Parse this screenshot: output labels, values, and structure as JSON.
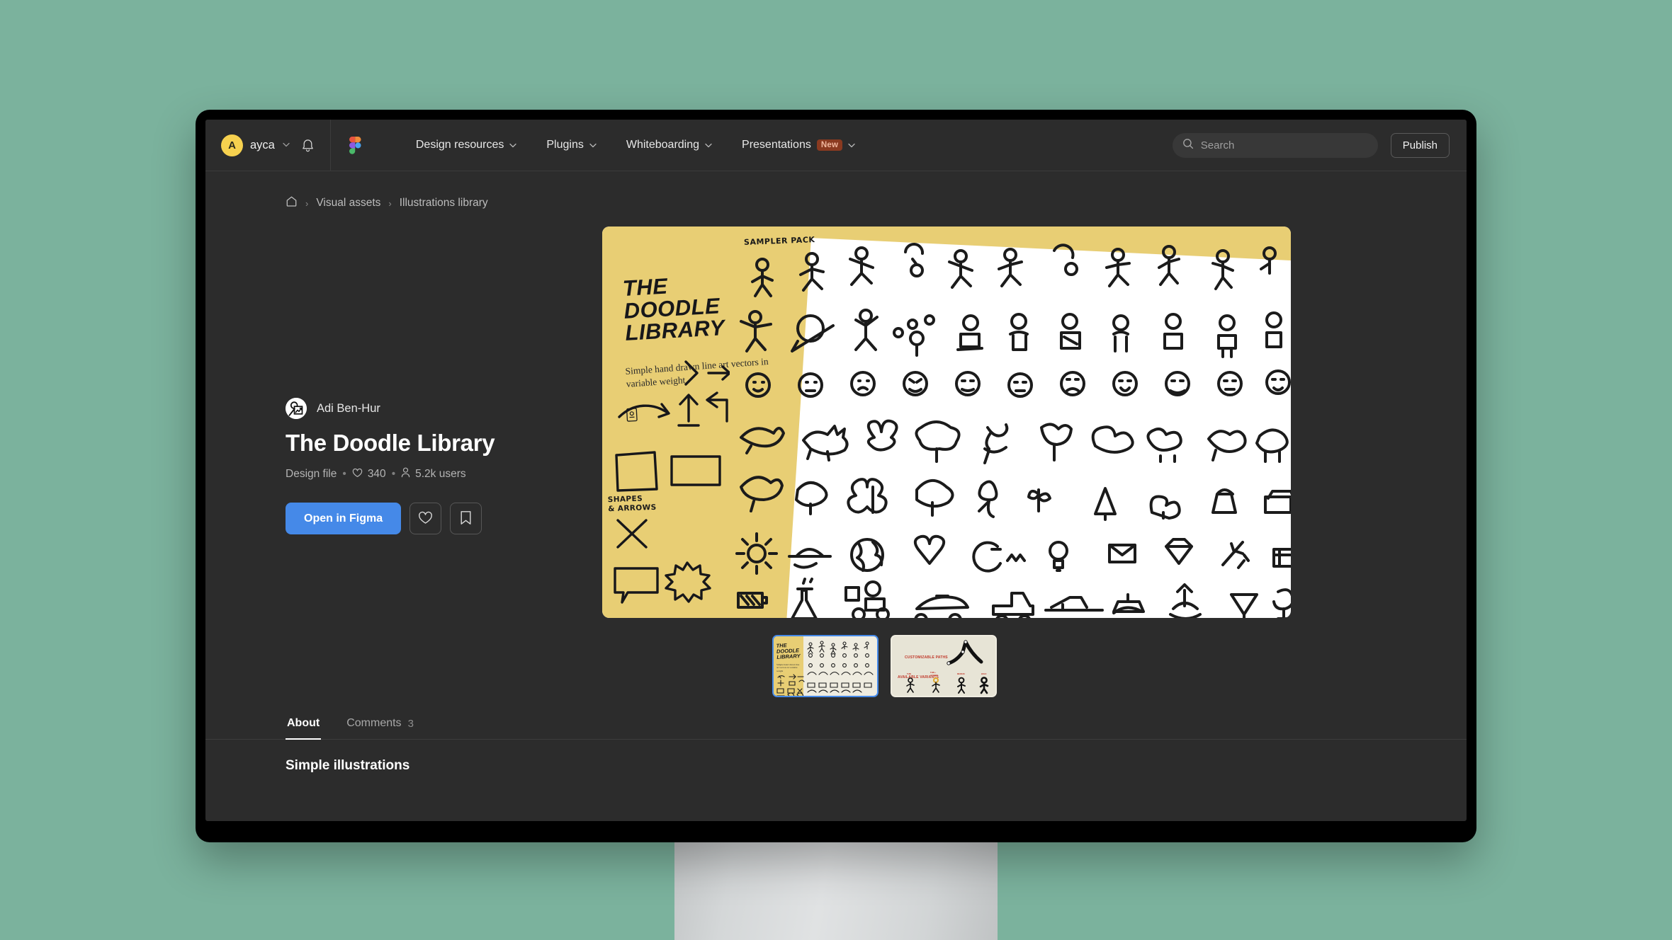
{
  "theme": {
    "page_background": "#7bb29d",
    "screen_background": "#2c2c2c",
    "accent_blue": "#4589e8",
    "avatar_yellow": "#f6d14f",
    "illustration_yellow": "#e8ce74"
  },
  "topbar": {
    "account": {
      "avatar_initial": "A",
      "name": "ayca",
      "caret": "⌄"
    },
    "notifications_icon": "bell-icon",
    "brand_icon": "figma-logo-icon",
    "nav_items": [
      {
        "label": "Design resources",
        "has_caret": true,
        "badge": ""
      },
      {
        "label": "Plugins",
        "has_caret": true,
        "badge": ""
      },
      {
        "label": "Whiteboarding",
        "has_caret": true,
        "badge": ""
      },
      {
        "label": "Presentations",
        "has_caret": true,
        "badge": "New"
      }
    ],
    "search": {
      "placeholder": "Search",
      "value": "",
      "icon": "search-icon"
    },
    "publish_label": "Publish"
  },
  "breadcrumb": {
    "home_icon": "home-icon",
    "separator": "›",
    "items": [
      "Visual assets",
      "Illustrations library"
    ]
  },
  "resource": {
    "author": "Adi Ben-Hur",
    "author_avatar_icon": "author-avatar-icon",
    "title": "The Doodle Library",
    "type_label": "Design file",
    "likes": "340",
    "likes_icon": "heart-icon",
    "users": "5.2k users",
    "users_icon": "person-icon",
    "separator": "•",
    "primary_action": "Open in Figma",
    "like_button_icon": "heart-outline-icon",
    "save_button_icon": "bookmark-icon"
  },
  "preview": {
    "cover_title": "THE\nDOODLE\nLIBRARY",
    "cover_subtitle": "Simple hand drawn line art vectors in variable weight",
    "label_sampler": "SAMPLER PACK",
    "label_shapes": "SHAPES\n& ARROWS",
    "cover_mark": "⛃"
  },
  "thumbnails": [
    {
      "name": "thumb-cover-grid",
      "selected": true,
      "title": "THE\nDOODLE\nLIBRARY",
      "subtitle": "Simple hand drawn line art vectors in variable weight"
    },
    {
      "name": "thumb-customizable-paths",
      "selected": false,
      "label_paths": "CUSTOMIZABLE PATHS",
      "label_variants": "AVAILABLE VARIANTS",
      "variants": [
        "THIN",
        "THIN + ACCENT",
        "MEDIUM",
        "BOLD"
      ]
    }
  ],
  "tabs": [
    {
      "label": "About",
      "count": "",
      "active": true
    },
    {
      "label": "Comments",
      "count": "3",
      "active": false
    }
  ],
  "below_tabs_text": "Simple illustrations"
}
